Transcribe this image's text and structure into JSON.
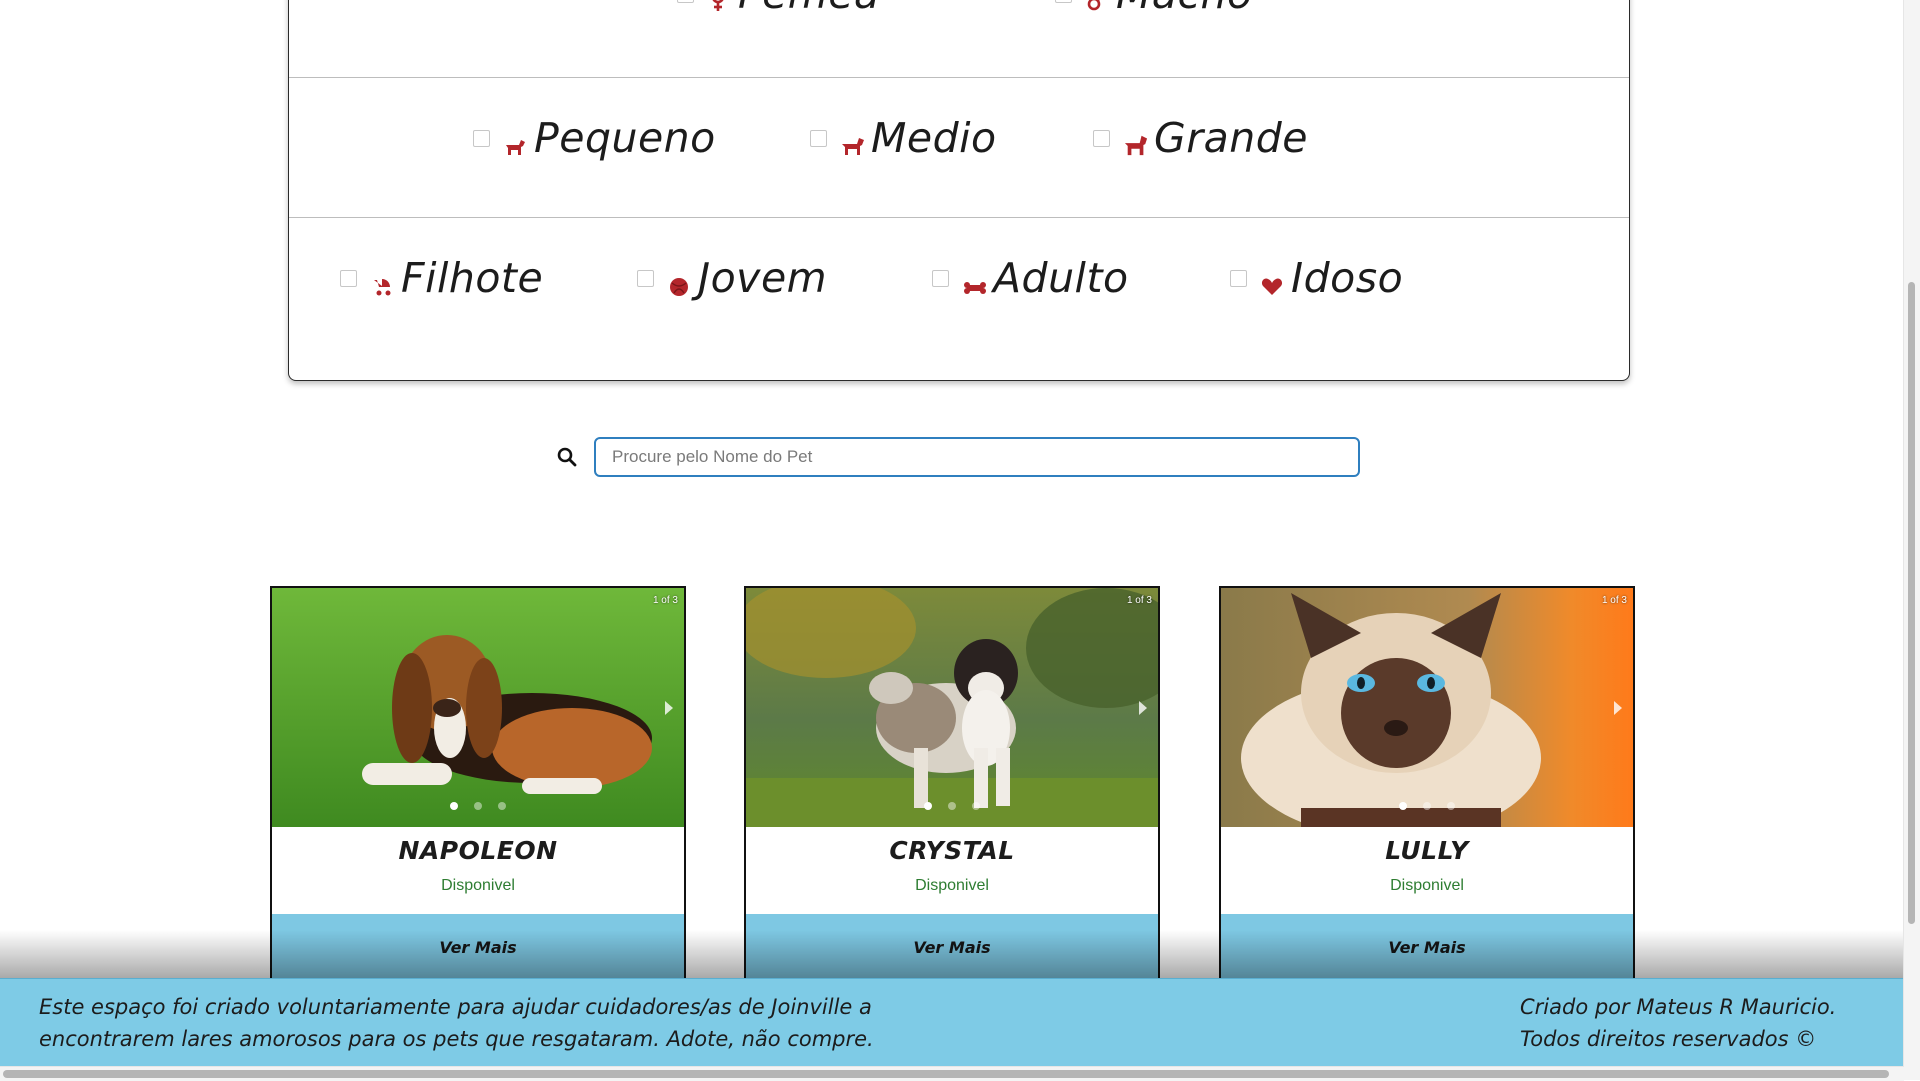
{
  "filters": {
    "sexo": [
      {
        "label": "Femea",
        "icon": "female-symbol-icon"
      },
      {
        "label": "Macho",
        "icon": "male-symbol-icon"
      }
    ],
    "porte": [
      {
        "label": "Pequeno",
        "icon": "small-dog-icon"
      },
      {
        "label": "Medio",
        "icon": "medium-dog-icon"
      },
      {
        "label": "Grande",
        "icon": "large-dog-icon"
      }
    ],
    "idade": [
      {
        "label": "Filhote",
        "icon": "baby-carriage-icon"
      },
      {
        "label": "Jovem",
        "icon": "ball-icon"
      },
      {
        "label": "Adulto",
        "icon": "bone-icon"
      },
      {
        "label": "Idoso",
        "icon": "heart-icon"
      }
    ],
    "icon_color": "#b3262b"
  },
  "search": {
    "placeholder": "Procure pelo Nome do Pet",
    "value": ""
  },
  "pets": [
    {
      "name": "NAPOLEON",
      "status": "Disponivel",
      "button": "Ver Mais",
      "counter": "1 of 3"
    },
    {
      "name": "CRYSTAL",
      "status": "Disponivel",
      "button": "Ver Mais",
      "counter": "1 of 3"
    },
    {
      "name": "LULLY",
      "status": "Disponivel",
      "button": "Ver Mais",
      "counter": "1 of 3"
    }
  ],
  "footer": {
    "left_line1": "Este espaço foi criado voluntariamente para ajudar cuidadores/as de Joinville a",
    "left_line2": "encontrarem lares amorosos para os pets que resgataram. Adote, não compre.",
    "right_line1": "Criado por Mateus R Mauricio.",
    "right_line2": "Todos direitos reservados ©"
  },
  "colors": {
    "accent_blue": "#7ecbe6",
    "status_green": "#2e7d32",
    "search_border": "#2f7fbf"
  }
}
